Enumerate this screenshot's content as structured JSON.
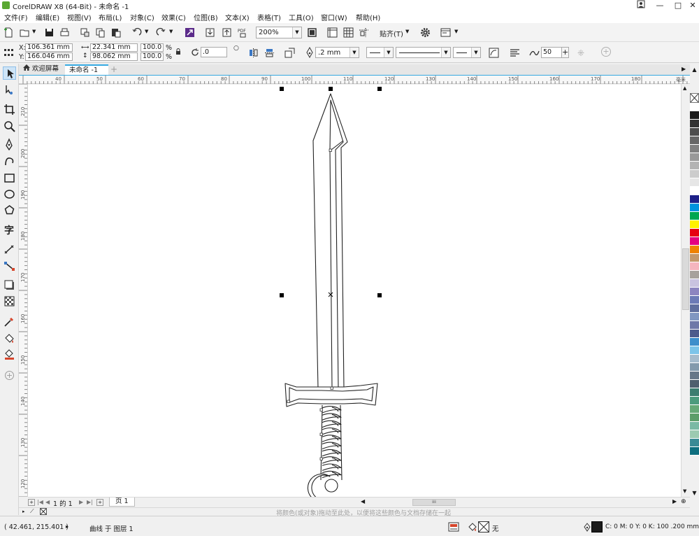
{
  "window": {
    "title": "CorelDRAW X8 (64-Bit) - 未命名 -1",
    "controls": [
      "?",
      "—",
      "□",
      "✕"
    ]
  },
  "menubar": {
    "items": [
      "文件(F)",
      "编辑(E)",
      "视图(V)",
      "布局(L)",
      "对象(C)",
      "效果(C)",
      "位图(B)",
      "文本(X)",
      "表格(T)",
      "工具(O)",
      "窗口(W)",
      "帮助(H)"
    ]
  },
  "toolbar": {
    "zoom": "200%",
    "snap_label": "贴齐(T)",
    "pdf_label": "PDF"
  },
  "propbar": {
    "x_label": "X:",
    "x_value": "106.361 mm",
    "y_label": "Y:",
    "y_value": "166.046 mm",
    "width_value": "22.341 mm",
    "height_value": "98.062 mm",
    "scale_w": "100.0",
    "scale_h": "100.0",
    "percent": "%",
    "rotation": ".0",
    "outline_width": ".2 mm",
    "smoothing": "50"
  },
  "tabs": {
    "welcome": "欢迎屏幕",
    "document": "未命名 -1",
    "add": "+"
  },
  "ruler": {
    "h_ticks": [
      "40",
      "50",
      "60",
      "70",
      "80",
      "90",
      "100",
      "110",
      "120",
      "130",
      "140",
      "150",
      "160",
      "170",
      "180"
    ],
    "units": "毫米",
    "v_ticks": [
      "210",
      "200",
      "190",
      "180",
      "170",
      "160",
      "150",
      "140",
      "130",
      "120"
    ]
  },
  "pages": {
    "counter": "1 的 1",
    "page_tab": "页 1"
  },
  "hint": "将颜色(或对象)拖动至此处，以便将这些颜色与文档存储在一起",
  "status": {
    "coords": "( 42.461, 215.401 )",
    "object_info": "曲线 于 图层 1",
    "fill_none": "无",
    "outline_info": "C: 0 M: 0 Y: 0 K: 100  .200 mm"
  },
  "palette": {
    "colors": [
      "#ffffff",
      "#1a1a1a",
      "#333333",
      "#4d4d4d",
      "#666666",
      "#808080",
      "#999999",
      "#b3b3b3",
      "#cccccc",
      "#e6e6e6",
      "#ffffff",
      "#1d2088",
      "#0093dd",
      "#00a650",
      "#fff100",
      "#e60012",
      "#e4007f",
      "#ef8200",
      "#c3986b",
      "#f5b5be",
      "#a7a19c",
      "#c9c3e0",
      "#8c85c0",
      "#6c7bb6",
      "#5f6f9e",
      "#8097c1",
      "#6e78a8",
      "#4d5a8c",
      "#3e8ecb",
      "#7cc4e9",
      "#a6bccd",
      "#839aac",
      "#667788",
      "#4f5f6e",
      "#3c7d70",
      "#4c9b7d",
      "#66a977",
      "#5c9e6a",
      "#7ab9a4",
      "#9ccab1",
      "#3a8a95",
      "#0f6f7f"
    ]
  }
}
